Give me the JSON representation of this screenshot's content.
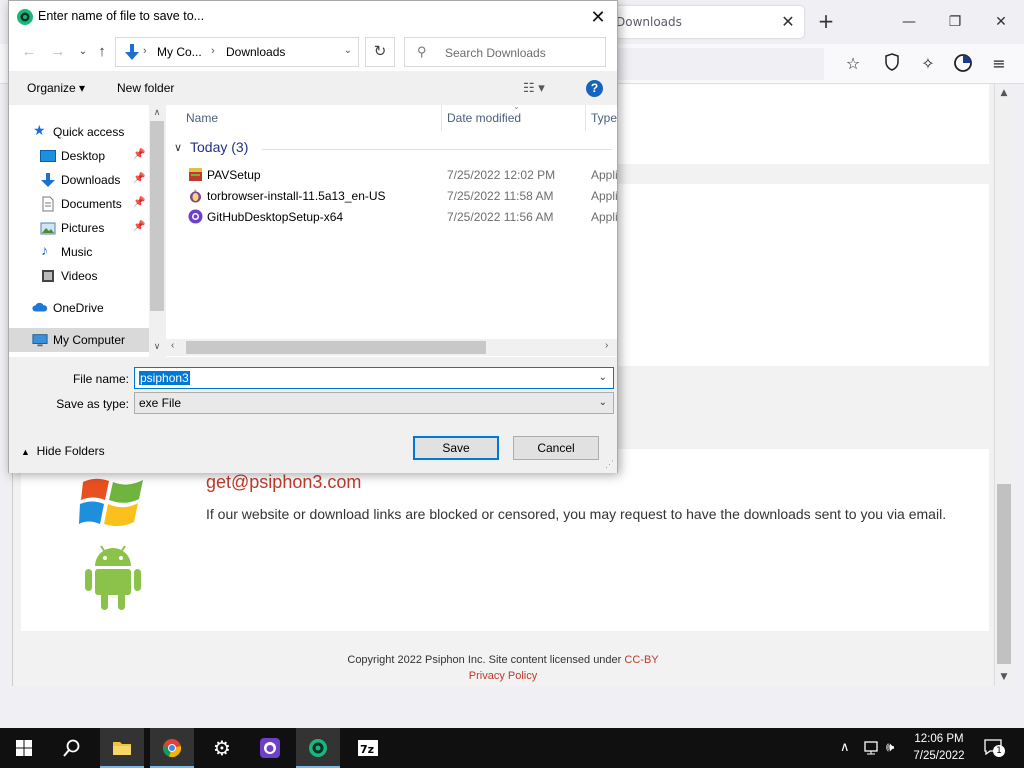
{
  "browser": {
    "tab_title": "Downloads",
    "tab_close": "✕",
    "new_tab": "+",
    "win_min": "—",
    "win_max": "❐",
    "win_close": "✕"
  },
  "page": {
    "email": "get@psiphon3.com",
    "email_desc": "If our website or download links are blocked or censored, you may request to have the downloads sent to you via email.",
    "copyright": "Copyright 2022 Psiphon Inc. Site content licensed under ",
    "license": "CC-BY",
    "privacy": "Privacy Policy"
  },
  "dialog": {
    "title": "Enter name of file to save to...",
    "close": "✕",
    "breadcrumb": [
      "My Co...",
      "Downloads"
    ],
    "search_placeholder": "Search Downloads",
    "organize": "Organize ▾",
    "new_folder": "New folder",
    "nav_items": [
      {
        "label": "Quick access",
        "icon": "star-icon"
      },
      {
        "label": "Desktop",
        "icon": "desktop-icon",
        "pinned": true
      },
      {
        "label": "Downloads",
        "icon": "download-icon",
        "pinned": true
      },
      {
        "label": "Documents",
        "icon": "document-icon",
        "pinned": true
      },
      {
        "label": "Pictures",
        "icon": "pictures-icon",
        "pinned": true
      },
      {
        "label": "Music",
        "icon": "music-icon"
      },
      {
        "label": "Videos",
        "icon": "video-icon"
      },
      {
        "label": "OneDrive",
        "icon": "cloud-icon"
      },
      {
        "label": "My Computer",
        "icon": "computer-icon",
        "selected": true
      }
    ],
    "columns": {
      "name": "Name",
      "date": "Date modified",
      "type": "Type"
    },
    "group": "Today (3)",
    "files": [
      {
        "name": "PAVSetup",
        "date": "7/25/2022 12:02 PM",
        "type": "Appli",
        "icon": "installer-icon"
      },
      {
        "name": "torbrowser-install-11.5a13_en-US",
        "date": "7/25/2022 11:58 AM",
        "type": "Appli",
        "icon": "tor-icon"
      },
      {
        "name": "GitHubDesktopSetup-x64",
        "date": "7/25/2022 11:56 AM",
        "type": "Appli",
        "icon": "github-icon"
      }
    ],
    "file_name_label": "File name:",
    "file_name_value": "psiphon3",
    "save_type_label": "Save as type:",
    "save_type_value": "exe File",
    "hide_folders": "Hide Folders",
    "save": "Save",
    "cancel": "Cancel"
  },
  "taskbar": {
    "time": "12:06 PM",
    "date": "7/25/2022",
    "notifications": "1",
    "apps": [
      "windows-start-icon",
      "search-icon",
      "file-explorer-icon",
      "chrome-icon",
      "settings-icon",
      "github-desktop-icon",
      "psiphon-icon",
      "7zip-icon"
    ]
  },
  "colors": {
    "accent": "#0078d7",
    "link_red": "#c0392b",
    "taskbar": "#101010"
  }
}
